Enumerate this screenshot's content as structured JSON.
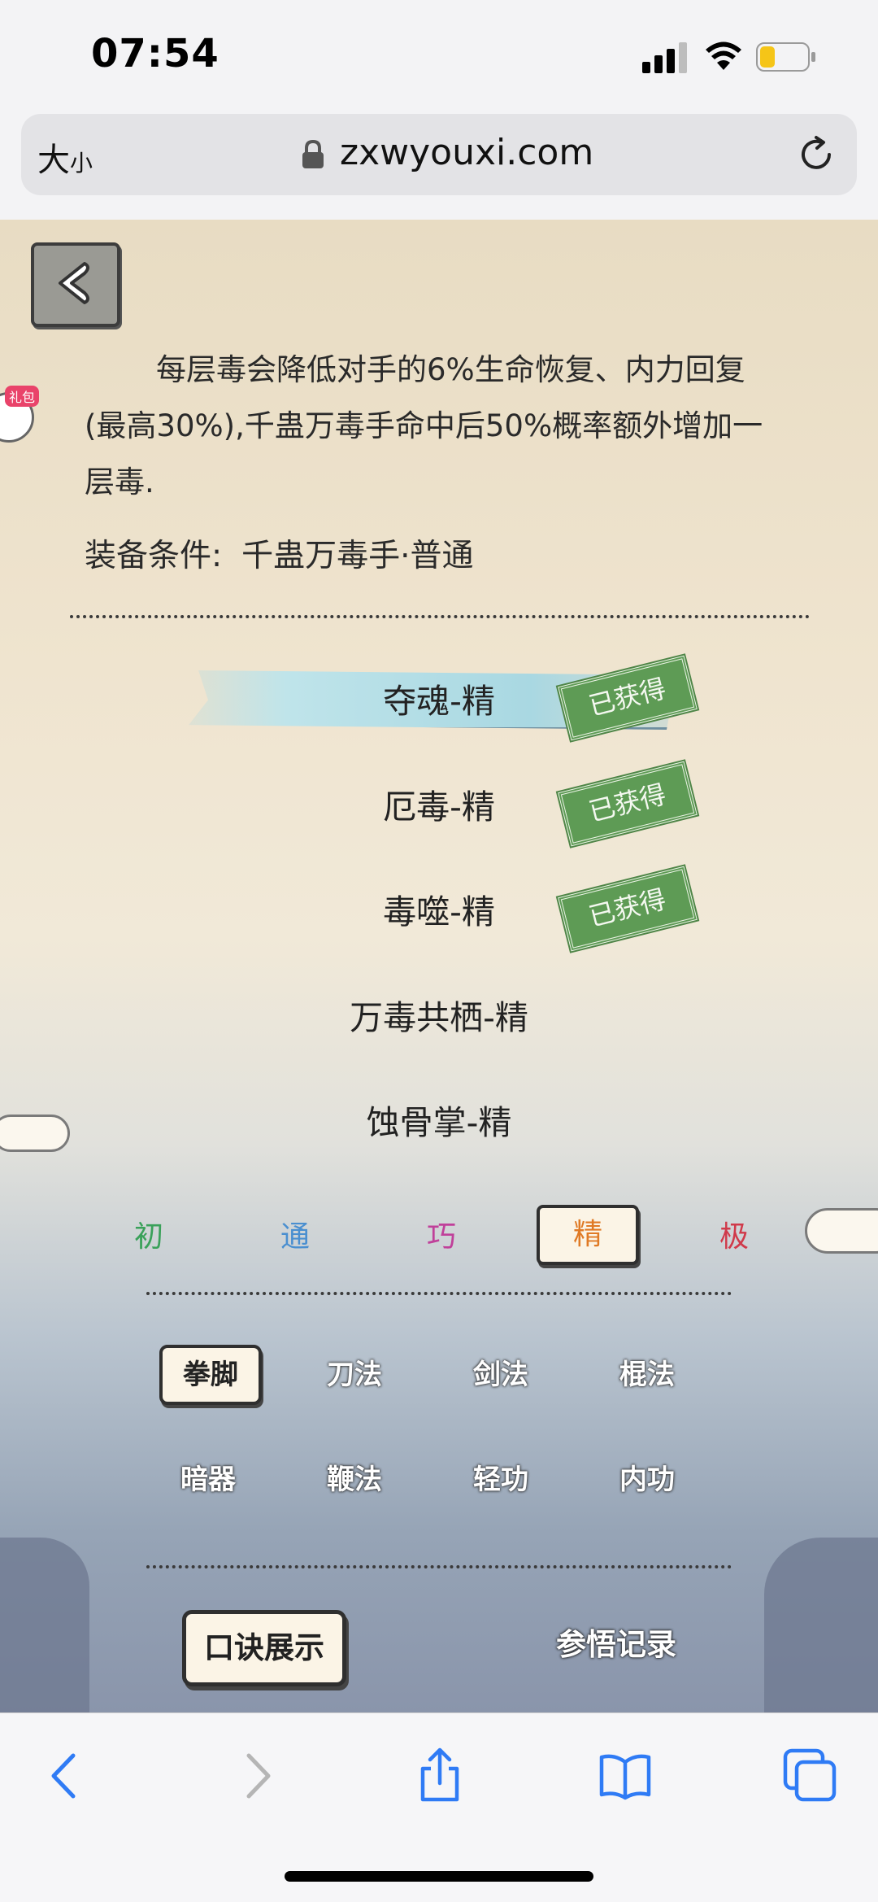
{
  "status": {
    "time": "07:54"
  },
  "browser": {
    "text_size_label": "大",
    "text_size_small": "小",
    "url": "zxwyouxi.com"
  },
  "game": {
    "gift_tag": "礼包",
    "description": "每层毒会降低对手的6%生命恢复、内力回复(最高30%),千蛊万毒手命中后50%概率额外增加一层毒.",
    "equip_label": "装备条件:",
    "equip_value": "千蛊万毒手·普通",
    "skills": [
      {
        "name": "夺魂-精",
        "obtained": true,
        "active": true
      },
      {
        "name": "厄毒-精",
        "obtained": true,
        "active": false
      },
      {
        "name": "毒噬-精",
        "obtained": true,
        "active": false
      },
      {
        "name": "万毒共栖-精",
        "obtained": false,
        "active": false
      },
      {
        "name": "蚀骨掌-精",
        "obtained": false,
        "active": false
      }
    ],
    "stamp_label": "已获得",
    "grades": [
      {
        "label": "初",
        "color": "#3aa15a"
      },
      {
        "label": "通",
        "color": "#4a8fd0"
      },
      {
        "label": "巧",
        "color": "#c0409a"
      },
      {
        "label": "精",
        "color": "#e07a25",
        "selected": true
      },
      {
        "label": "极",
        "color": "#d03a4a"
      }
    ],
    "categories": [
      {
        "label": "拳脚",
        "selected": true
      },
      {
        "label": "刀法"
      },
      {
        "label": "剑法"
      },
      {
        "label": "棍法"
      },
      {
        "label": "暗器"
      },
      {
        "label": "鞭法"
      },
      {
        "label": "轻功"
      },
      {
        "label": "内功"
      }
    ],
    "mantra_button": "口诀展示",
    "record_button": "参悟记录"
  },
  "toolbar": {
    "icons": [
      "back-icon",
      "forward-icon",
      "share-icon",
      "bookmarks-icon",
      "tabs-icon"
    ],
    "accent": "#2f7bf5"
  }
}
